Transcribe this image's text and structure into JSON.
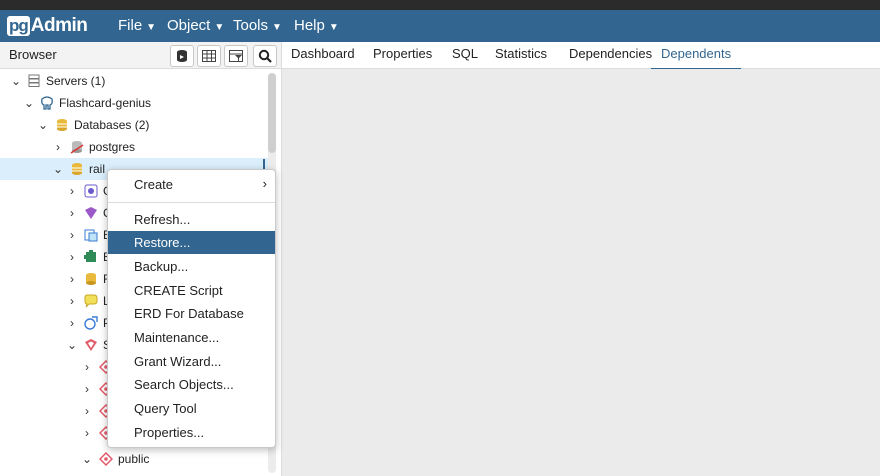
{
  "app": {
    "logo_box": "pg",
    "logo_text": "Admin"
  },
  "navbar": {
    "menus": [
      "File",
      "Object",
      "Tools",
      "Help"
    ]
  },
  "browser_panel": {
    "title": "Browser"
  },
  "tabs": [
    "Dashboard",
    "Properties",
    "SQL",
    "Statistics",
    "Dependencies",
    "Dependents"
  ],
  "active_tab": "Dependents",
  "tree": {
    "servers": "Servers (1)",
    "server": "Flashcard-genius",
    "databases": "Databases (2)",
    "db_postgres": "postgres",
    "db_rails": "rail",
    "child_letters": [
      "C",
      "C",
      "E",
      "E",
      "F",
      "L",
      "P",
      "S"
    ],
    "schema_letters": [
      "",
      "",
      "",
      ""
    ],
    "public": "public"
  },
  "context_menu": {
    "items": [
      "Create",
      "Refresh...",
      "Restore...",
      "Backup...",
      "CREATE Script",
      "ERD For Database",
      "Maintenance...",
      "Grant Wizard...",
      "Search Objects...",
      "Query Tool",
      "Properties..."
    ],
    "highlighted": "Restore..."
  },
  "colors": {
    "accent": "#326690",
    "selection": "#dbeefb",
    "db_icon": "#e8b93b"
  }
}
